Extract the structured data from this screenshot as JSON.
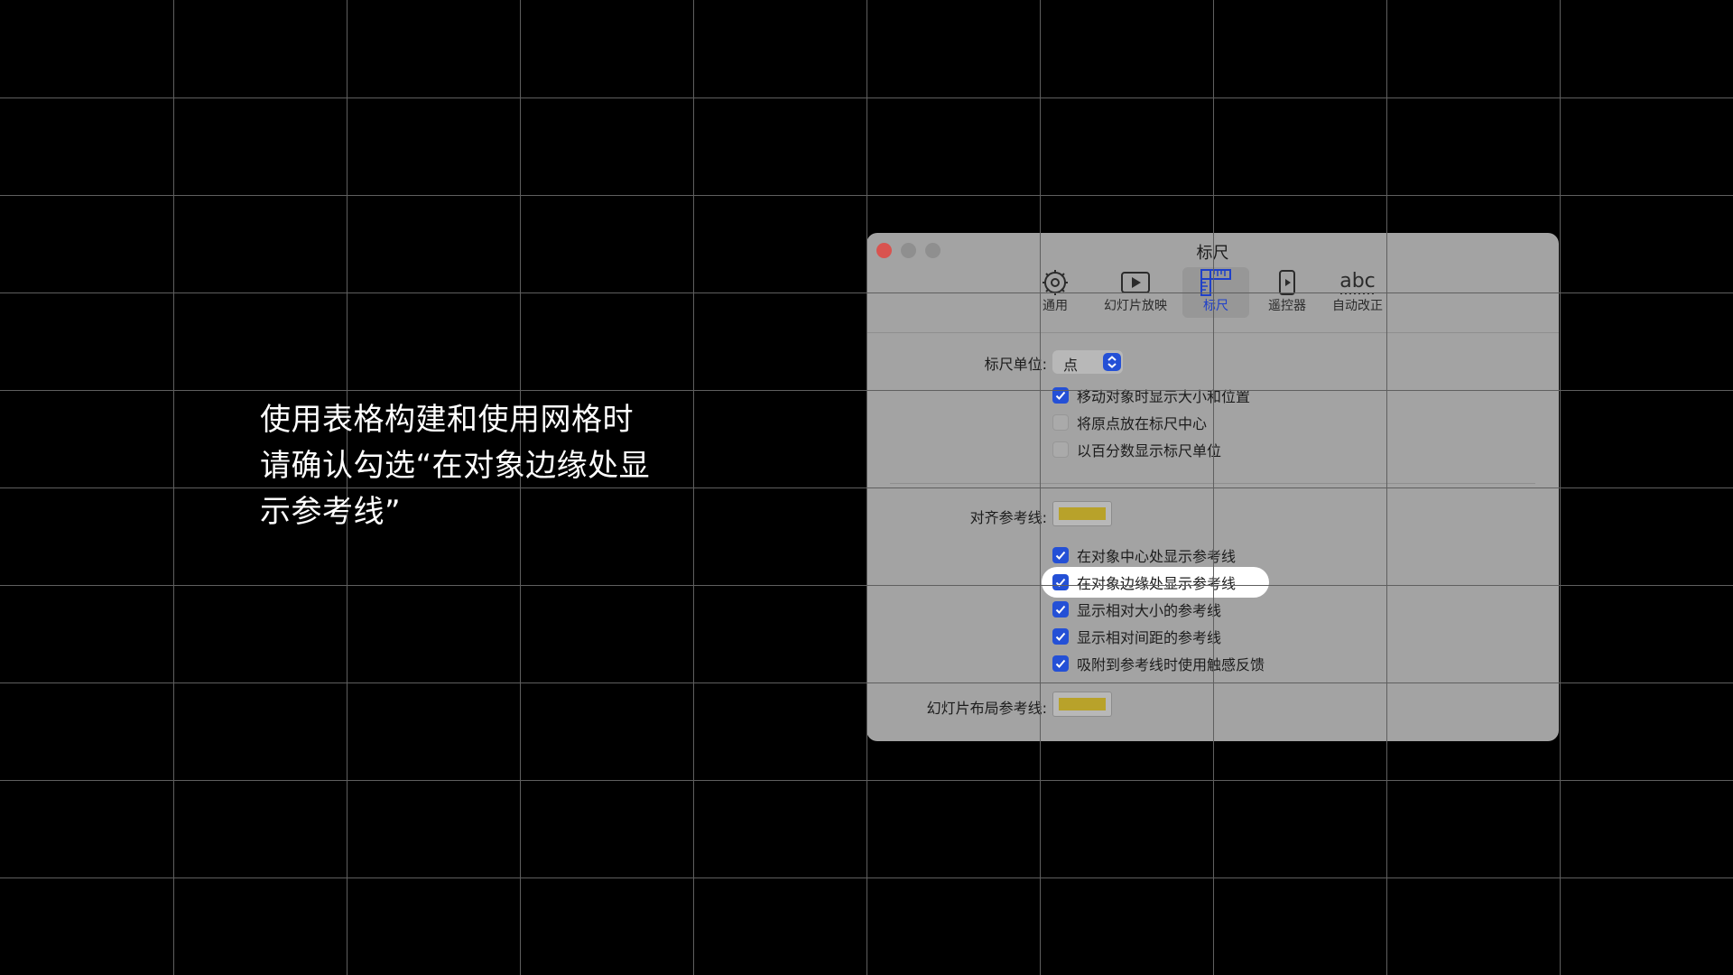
{
  "caption": {
    "line1": "使用表格构建和使用网格时",
    "line2": "请确认勾选“在对象边缘处显",
    "line3": "示参考线”"
  },
  "window": {
    "title": "标尺",
    "toolbar": [
      {
        "label": "通用",
        "icon": "gear-icon"
      },
      {
        "label": "幻灯片放映",
        "icon": "play-icon"
      },
      {
        "label": "标尺",
        "icon": "ruler-icon",
        "selected": true
      },
      {
        "label": "遥控器",
        "icon": "remote-icon"
      },
      {
        "label": "自动改正",
        "icon": "abc-icon"
      }
    ],
    "ruler_units": {
      "label": "标尺单位:",
      "value": "点"
    },
    "options": [
      {
        "label": "移动对象时显示大小和位置",
        "checked": true
      },
      {
        "label": "将原点放在标尺中心",
        "checked": false
      },
      {
        "label": "以百分数显示标尺单位",
        "checked": false
      }
    ],
    "alignment_guides": {
      "label": "对齐参考线:",
      "color": "#b8a22a"
    },
    "guide_options": [
      {
        "label": "在对象中心处显示参考线",
        "checked": true
      },
      {
        "label": "在对象边缘处显示参考线",
        "checked": true,
        "highlighted": true
      },
      {
        "label": "显示相对大小的参考线",
        "checked": true
      },
      {
        "label": "显示相对间距的参考线",
        "checked": true
      },
      {
        "label": "吸附到参考线时使用触感反馈",
        "checked": true
      }
    ],
    "slide_layout_guides": {
      "label": "幻灯片布局参考线:",
      "color": "#b8a22a"
    }
  },
  "colors": {
    "accent": "#2450d6",
    "background": "#000000",
    "window": "#a3a3a3",
    "grid": "#5f5f5f"
  }
}
